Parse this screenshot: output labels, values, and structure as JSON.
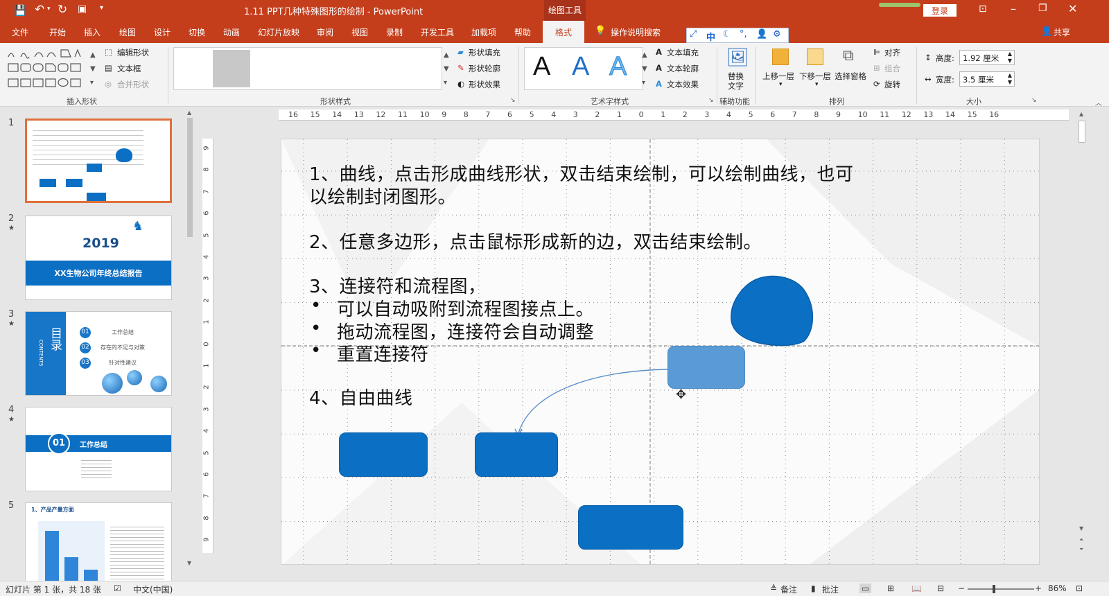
{
  "window": {
    "title": "1.11 PPT几种特殊图形的绘制 - PowerPoint",
    "context_tab": "绘图工具",
    "login": "登录"
  },
  "tabs": [
    "文件",
    "开始",
    "插入",
    "绘图",
    "设计",
    "切换",
    "动画",
    "幻灯片放映",
    "审阅",
    "视图",
    "录制",
    "开发工具",
    "加载项",
    "帮助",
    "格式"
  ],
  "tell_me": "操作说明搜索",
  "share": "共享",
  "ribbon": {
    "groups": {
      "insert_shapes": "插入形状",
      "shape_styles": "形状样式",
      "wordart_styles": "艺术字样式",
      "accessibility": "辅助功能",
      "arrange": "排列",
      "size": "大小"
    },
    "edit_shape": "编辑形状",
    "text_box": "文本框",
    "merge_shapes": "合并形状",
    "shape_fill": "形状填充",
    "shape_outline": "形状轮廓",
    "shape_effects": "形状效果",
    "text_fill": "文本填充",
    "text_outline": "文本轮廓",
    "text_effects": "文本效果",
    "wordart_letter": "A",
    "alt_text_1": "替换",
    "alt_text_2": "文字",
    "bring_forward": "上移一层",
    "send_backward": "下移一层",
    "selection_pane": "选择窗格",
    "align": "对齐",
    "group": "组合",
    "rotate": "旋转",
    "height_label": "高度:",
    "height_value": "1.92 厘米",
    "width_label": "宽度:",
    "width_value": "3.5 厘米"
  },
  "ime": {
    "lang": "中"
  },
  "ruler": {
    "top": [
      "16",
      "15",
      "14",
      "13",
      "12",
      "11",
      "10",
      "9",
      "8",
      "7",
      "6",
      "5",
      "4",
      "3",
      "2",
      "1",
      "0",
      "1",
      "2",
      "3",
      "4",
      "5",
      "6",
      "7",
      "8",
      "9",
      "10",
      "11",
      "12",
      "13",
      "14",
      "15",
      "16"
    ],
    "left": [
      "9",
      "8",
      "7",
      "6",
      "5",
      "4",
      "3",
      "2",
      "1",
      "0",
      "1",
      "2",
      "3",
      "4",
      "5",
      "6",
      "7",
      "8",
      "9"
    ]
  },
  "slides": {
    "numbers": [
      "1",
      "2",
      "3",
      "4",
      "5"
    ],
    "s2_year": "2019",
    "s2_title": "XX生物公司年终总结报告",
    "s3_title": "目录",
    "s3_sub": "CONTENTS",
    "s3_items": [
      "工作总结",
      "存在的不足与对策",
      "针对性建议"
    ],
    "s3_nums": [
      "01",
      "02",
      "03"
    ],
    "s4_num": "01",
    "s4_title": "工作总结",
    "s5_title": "1、产品产量方面"
  },
  "slide": {
    "line1a": "1、曲线，点击形成曲线形状，双击结束绘制，可以绘制曲线，也可",
    "line1b": "以绘制封闭图形。",
    "line2": "2、任意多边形，点击鼠标形成新的边，双击结束绘制。",
    "line3": "3、连接符和流程图，",
    "bullets": [
      "可以自动吸附到流程图接点上。",
      "拖动流程图，连接符会自动调整",
      "重置连接符"
    ],
    "line4": "4、自由曲线"
  },
  "status": {
    "slide_info": "幻灯片 第 1 张，共 18 张",
    "language": "中文(中国)",
    "notes": "备注",
    "comments": "批注",
    "zoom": "86%"
  },
  "colors": {
    "accent": "#c43e1c",
    "shape_blue": "#0b6fc4",
    "selected_shape": "#5b9bd5"
  }
}
